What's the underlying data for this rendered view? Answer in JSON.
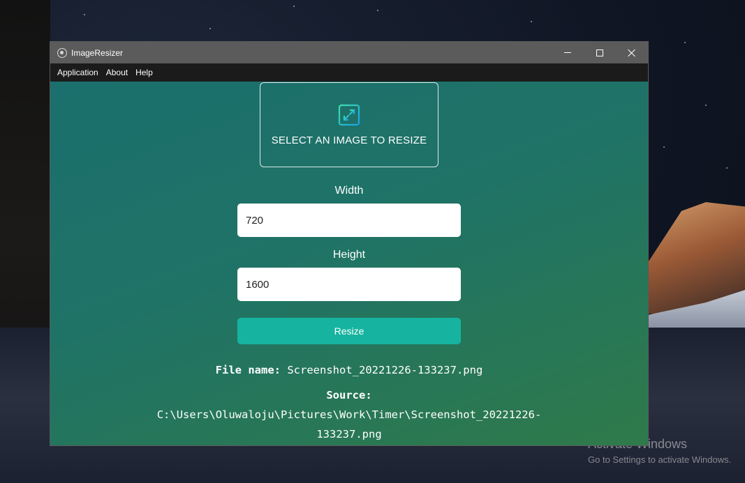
{
  "window": {
    "title": "ImageResizer",
    "icon": "electron-icon"
  },
  "menu": {
    "items": [
      "Application",
      "About",
      "Help"
    ]
  },
  "select": {
    "label": "SELECT AN IMAGE TO RESIZE",
    "icon": "expand-arrows-icon"
  },
  "form": {
    "width_label": "Width",
    "width_value": "720",
    "height_label": "Height",
    "height_value": "1600",
    "resize_label": "Resize"
  },
  "file_info": {
    "name_label": "File name:",
    "name_value": "Screenshot_20221226-133237.png",
    "source_label": "Source:",
    "source_line1": "C:\\Users\\Oluwaloju\\Pictures\\Work\\Timer\\Screenshot_20221226-",
    "source_line2": "133237.png"
  },
  "watermark": {
    "title": "Activate Windows",
    "subtitle": "Go to Settings to activate Windows."
  },
  "colors": {
    "accent": "#16b4a0",
    "titlebar": "#5b5b5b",
    "menubar": "#1b1b1b",
    "content_gradient_start": "#1b6f6d",
    "content_gradient_end": "#2f7a4a"
  }
}
